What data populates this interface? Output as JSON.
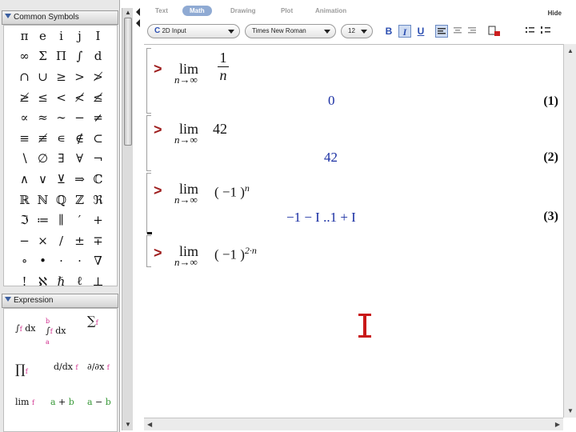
{
  "palettes": {
    "common_symbols": {
      "title": "Common Symbols",
      "symbols": [
        "π",
        "e",
        "i",
        "j",
        "I",
        "∞",
        "Σ",
        "Π",
        "∫",
        "d",
        "∩",
        "∪",
        "≥",
        ">",
        "≯",
        "≱",
        "≤",
        "<",
        "≮",
        "≰",
        "∝",
        "≈",
        "∼",
        "−",
        "≠",
        "≡",
        "≢",
        "∊",
        "∉",
        "⊂",
        "∖",
        "∅",
        "∃",
        "∀",
        "¬",
        "∧",
        "∨",
        "⊻",
        "⇒",
        "ℂ",
        "ℝ",
        "ℕ",
        "ℚ",
        "ℤ",
        "ℜ",
        "ℑ",
        "≔",
        "∥",
        "′",
        "+",
        "−",
        "×",
        "/",
        "±",
        "∓",
        "∘",
        "•",
        "·",
        "·",
        "∇",
        "!",
        "ℵ",
        "ℏ",
        "ℓ",
        "⊥"
      ]
    },
    "expression": {
      "title": "Expression"
    }
  },
  "tabs": [
    {
      "label": "Text",
      "active": false
    },
    {
      "label": "Math",
      "active": true
    },
    {
      "label": "Drawing",
      "active": false
    },
    {
      "label": "Plot",
      "active": false
    },
    {
      "label": "Animation",
      "active": false
    }
  ],
  "hide_label": "Hide",
  "toolbar": {
    "input_mode": "2D Input",
    "font": "Times New Roman",
    "size": "12",
    "bold": "B",
    "italic": "I",
    "underline": "U",
    "accent_color": "#2a4db0"
  },
  "document": {
    "prompt": ">",
    "lim": "lim",
    "sub": "n→∞",
    "rows": [
      {
        "expr": "1/n",
        "result": "0",
        "label": "(1)"
      },
      {
        "expr": "42",
        "result": "42",
        "label": "(2)"
      },
      {
        "expr": "(−1)^n",
        "result": "−1 − I ..1 + I",
        "label": "(3)"
      },
      {
        "expr": "(−1)^(2·n)",
        "result": "",
        "label": ""
      }
    ],
    "result_color": "#1a2fa3",
    "prompt_color": "#9e1d1d"
  }
}
